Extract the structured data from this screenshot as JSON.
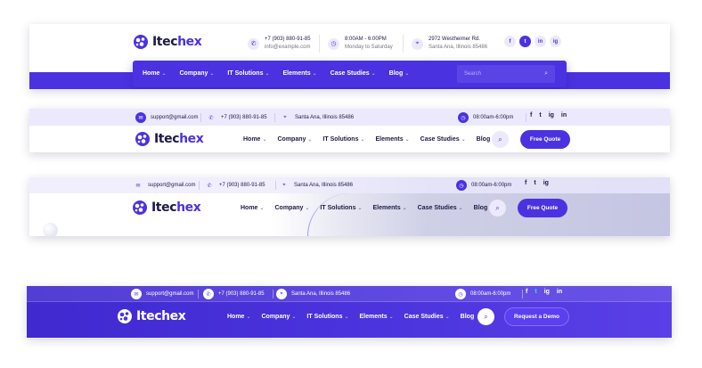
{
  "brand": {
    "logo_prefix": "Itec",
    "logo_suffix": "hex"
  },
  "colors": {
    "primary": "#4b32e0",
    "dark": "#1c1a44",
    "lavender": "#ece9fd"
  },
  "nav": {
    "home": "Home",
    "company": "Company",
    "it_solutions": "IT Solutions",
    "elements": "Elements",
    "case_studies": "Case Studies",
    "blog": "Blog"
  },
  "header1": {
    "phone": "+7 (903) 880-91-85",
    "email": "info@example.com",
    "hours": "8:00AM - 6:00PM",
    "days": "Monday to Saturday",
    "address_line1": "2972 Westheimer Rd.",
    "address_line2": "Santa Ana, Illinois 85486",
    "search_placeholder": "Search",
    "socials": [
      "f",
      "t",
      "in",
      "ig"
    ]
  },
  "header2": {
    "email": "support@gmail.com",
    "phone": "+7 (903) 880-91-85",
    "address": "Santa Ana, Illinois 85486",
    "hours": "08:00am-6:00pm",
    "cta": "Free Quote"
  },
  "header3": {
    "email": "support@gmail.com",
    "phone": "+7 (903) 880-91-85",
    "address": "Santa Ana, Illinois 85486",
    "hours": "08:00am-6:00pm",
    "cta": "Free Quote"
  },
  "header4": {
    "email": "support@gmail.com",
    "phone": "+7 (903) 880-91-85",
    "address": "Santa Ana, Illinois 85486",
    "hours": "08:00am-6:00pm",
    "cta": "Request a Demo"
  },
  "icons": {
    "phone": "phone-icon",
    "email": "mail-icon",
    "clock": "clock-icon",
    "location": "map-pin-icon",
    "search": "search-icon",
    "chevron": "chevron-down-icon"
  }
}
